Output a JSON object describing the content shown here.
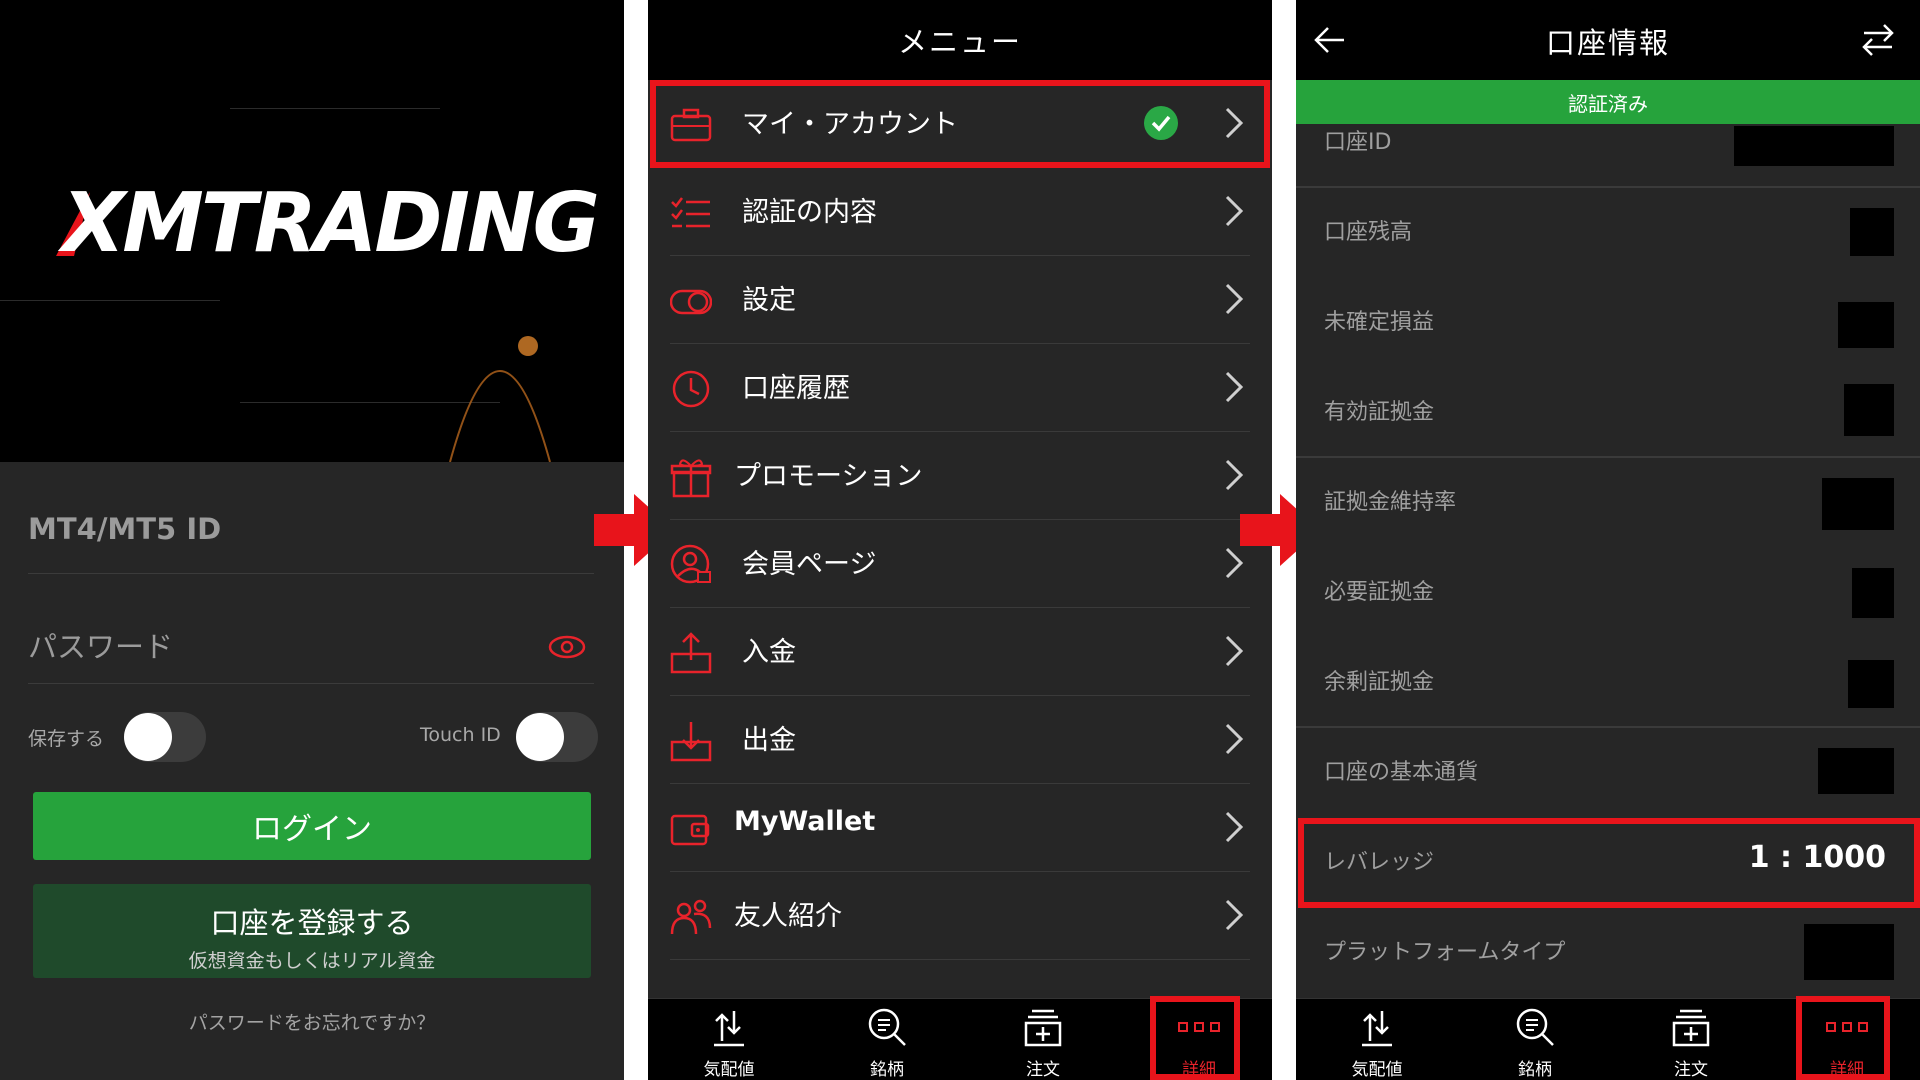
{
  "login": {
    "logo_text": "XMTRADING",
    "id_placeholder": "MT4/MT5 ID",
    "password_placeholder": "パスワード",
    "save_label": "保存する",
    "touchid_label": "Touch ID",
    "login_button": "ログイン",
    "register_button": "口座を登録する",
    "register_sub": "仮想資金もしくはリアル資金",
    "forgot_link": "パスワードをお忘れですか？"
  },
  "menu": {
    "title": "メニュー",
    "items": [
      {
        "label": "マイ・アカウント",
        "icon": "briefcase-icon",
        "verified": true
      },
      {
        "label": "認証の内容",
        "icon": "checklist-icon"
      },
      {
        "label": "設定",
        "icon": "toggle-settings-icon"
      },
      {
        "label": "口座履歴",
        "icon": "clock-icon"
      },
      {
        "label": "プロモーション",
        "icon": "gift-icon"
      },
      {
        "label": "会員ページ",
        "icon": "user-lock-icon"
      },
      {
        "label": "入金",
        "icon": "deposit-icon"
      },
      {
        "label": "出金",
        "icon": "withdraw-icon"
      },
      {
        "label": "MyWallet",
        "icon": "wallet-icon"
      },
      {
        "label": "友人紹介",
        "icon": "friends-icon"
      }
    ]
  },
  "tabs": [
    {
      "label": "気配値",
      "icon": "quotes-icon"
    },
    {
      "label": "銘柄",
      "icon": "symbol-search-icon"
    },
    {
      "label": "注文",
      "icon": "order-icon"
    },
    {
      "label": "詳細",
      "icon": "details-icon",
      "active": true
    }
  ],
  "account": {
    "title": "口座情報",
    "verified_banner": "認証済み",
    "rows": [
      {
        "label": "口座ID"
      },
      {
        "label": "口座残高"
      },
      {
        "label": "未確定損益"
      },
      {
        "label": "有効証拠金"
      },
      {
        "label": "証拠金維持率"
      },
      {
        "label": "必要証拠金"
      },
      {
        "label": "余剰証拠金"
      },
      {
        "label": "口座の基本通貨"
      },
      {
        "label": "レバレッジ",
        "value": "1 : 1000"
      },
      {
        "label": "プラットフォームタイプ"
      }
    ]
  },
  "colors": {
    "accent_red": "#e8141b",
    "button_green": "#26a33c",
    "register_green": "#1f4a2b",
    "background": "#262626"
  }
}
